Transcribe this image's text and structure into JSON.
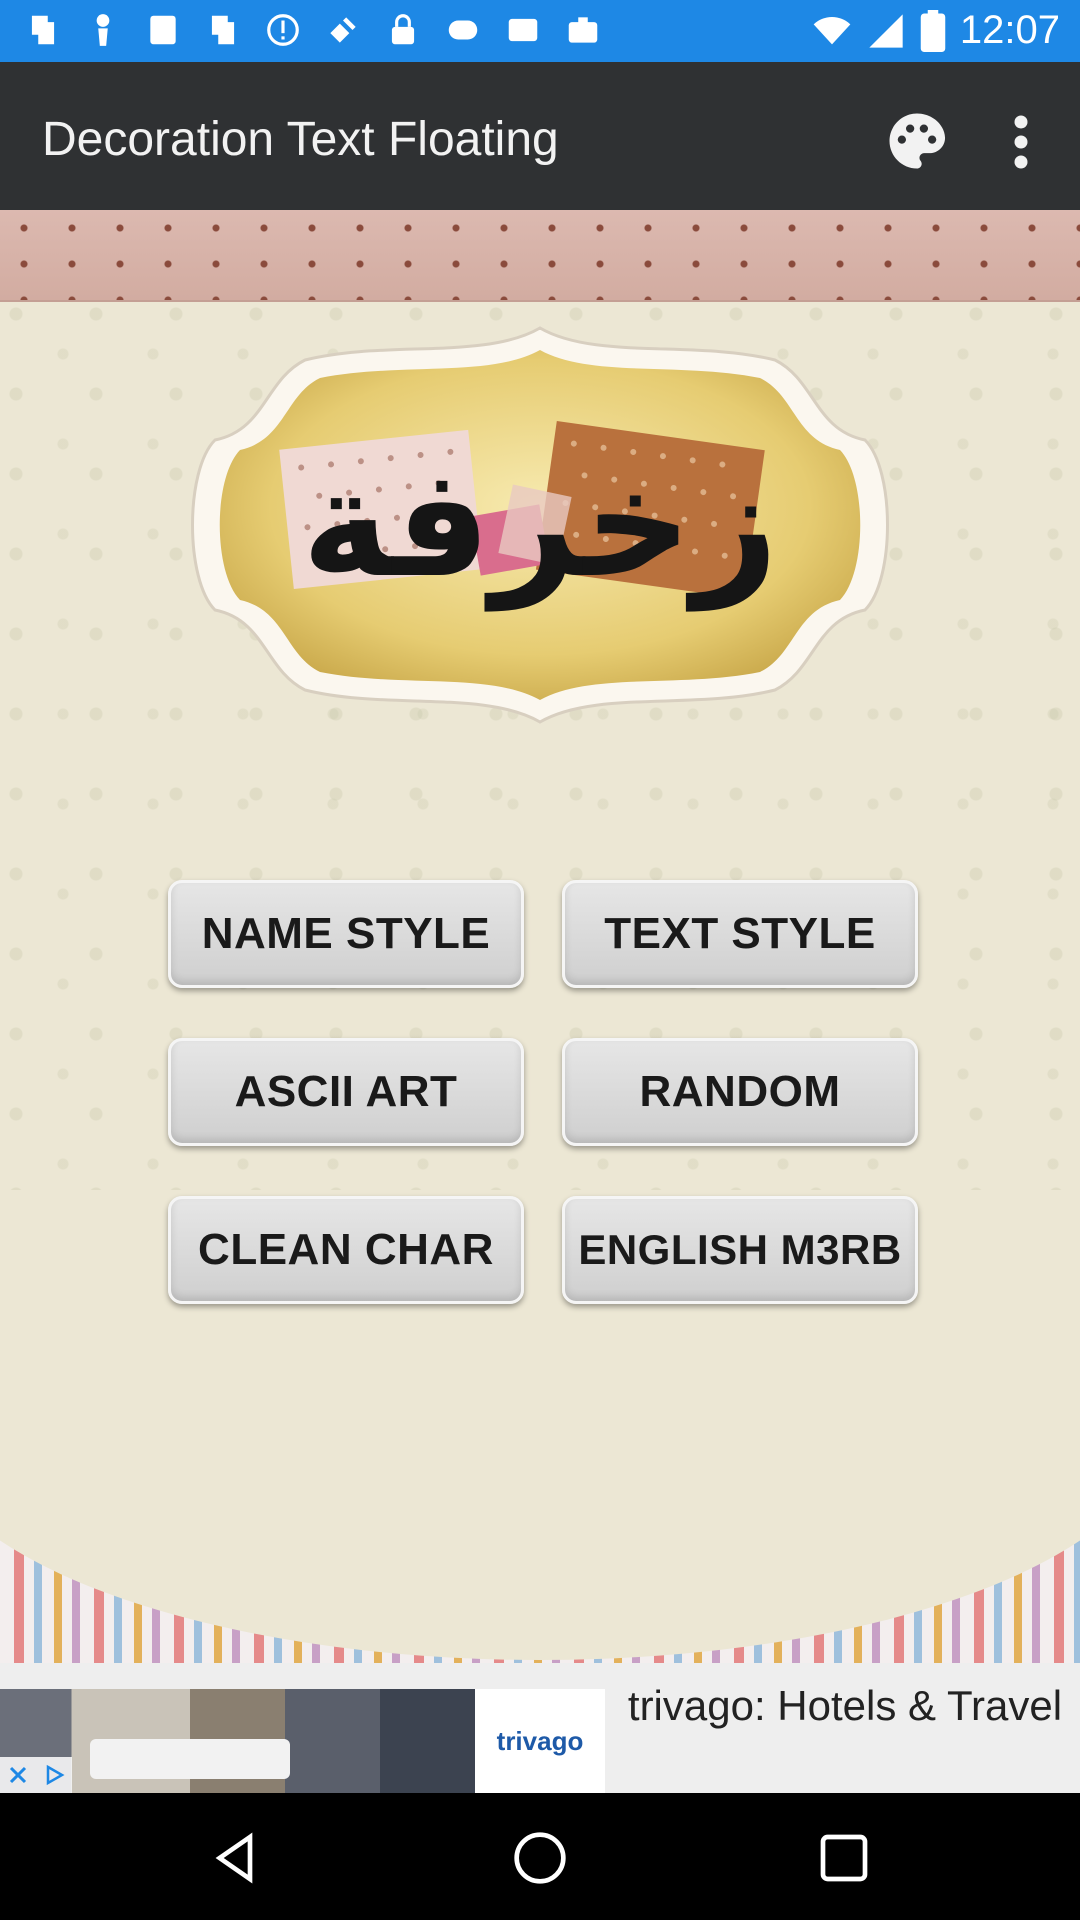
{
  "status_bar": {
    "time": "12:07",
    "notification_icons": [
      "app-icon",
      "podium-icon",
      "app-icon",
      "app-icon",
      "alert-icon",
      "satellite-icon",
      "lock-icon",
      "app-icon",
      "image-icon",
      "briefcase-icon"
    ]
  },
  "app_bar": {
    "title": "Decoration Text Floating",
    "actions": [
      "palette-icon",
      "more-vert-icon"
    ]
  },
  "menu": {
    "name_style": "NAME STYLE",
    "text_style": "TEXT STYLE",
    "ascii_art": "ASCII ART",
    "random": "RANDOM",
    "clean_char": "CLEAN CHAR",
    "english_m3rb": "ENGLISH M3RB"
  },
  "logo": {
    "text": "زخرفة"
  },
  "ad": {
    "text": "trivago: Hotels & Travel",
    "brand": "trivago"
  },
  "colors": {
    "status_bar": "#1e88e5",
    "app_bar": "#2f3133",
    "background": "#ece7d4"
  }
}
